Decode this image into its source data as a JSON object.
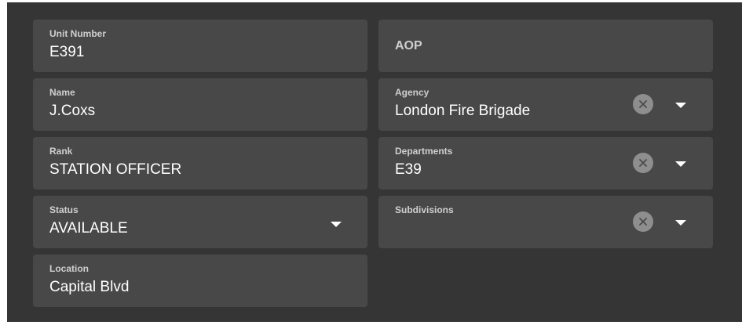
{
  "form": {
    "unit_number": {
      "label": "Unit Number",
      "value": "E391"
    },
    "name": {
      "label": "Name",
      "value": "J.Coxs"
    },
    "rank": {
      "label": "Rank",
      "value": "STATION OFFICER"
    },
    "status": {
      "label": "Status",
      "value": "AVAILABLE"
    },
    "location": {
      "label": "Location",
      "value": "Capital Blvd"
    },
    "aop": {
      "placeholder": "AOP"
    },
    "agency": {
      "label": "Agency",
      "value": "London Fire Brigade"
    },
    "departments": {
      "label": "Departments",
      "value": "E39"
    },
    "subdivisions": {
      "label": "Subdivisions",
      "value": ""
    }
  },
  "colors": {
    "panel_background": "#353535",
    "field_background": "#484848",
    "label_text": "#cfcfcf",
    "value_text": "#ffffff",
    "clear_button": "#8e8e8e"
  },
  "icons": {
    "clear": "clear-x-icon",
    "dropdown": "dropdown-caret-icon"
  }
}
